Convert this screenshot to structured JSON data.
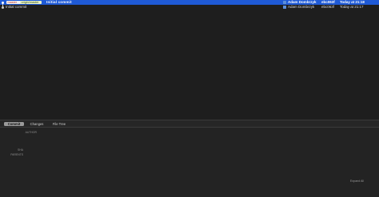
{
  "history": {
    "rows": [
      {
        "refs": [
          "master",
          "origin/master"
        ],
        "subject": "Initial commit",
        "author": "Adam Dombrzyk",
        "sha": "ebc063f",
        "date": "Today at 21:18",
        "selected": true
      },
      {
        "refs": [],
        "subject": "Initial commit",
        "author": "Adam Dombrzyk",
        "sha": "ebc063f",
        "date": "Today at 21:17",
        "selected": false
      }
    ]
  },
  "tabs": [
    {
      "label": "Commit",
      "active": true
    },
    {
      "label": "Changes",
      "active": false
    },
    {
      "label": "File Tree",
      "active": false
    }
  ],
  "details": {
    "author_label": "AUTHOR",
    "sha_label": "SHA",
    "parents_label": "PARENTS",
    "expand_label": "Expand All"
  },
  "colors": {
    "selection": "#1f5ad6",
    "background": "#1e1e1e",
    "panel": "#232323"
  }
}
